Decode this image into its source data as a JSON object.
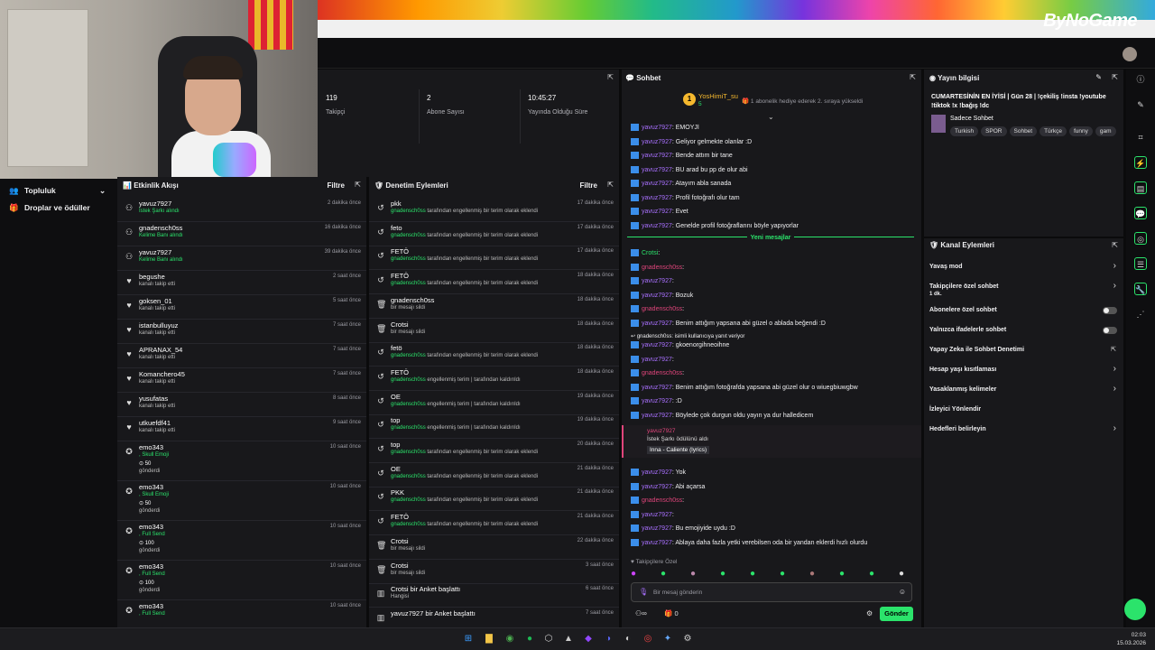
{
  "banner": {
    "logo": "ByNoGame"
  },
  "stats": [
    {
      "value": "119",
      "label": "Takipçi"
    },
    {
      "value": "2",
      "label": "Abone Sayısı"
    },
    {
      "value": "10:45:27",
      "label": "Yayında Olduğu Süre"
    }
  ],
  "side_nav": {
    "items": [
      "Topluluk",
      "Droplar ve ödüller"
    ]
  },
  "activity": {
    "title": "Etkinlik Akışı",
    "filter": "Filtre",
    "items": [
      {
        "name": "yavuz7927",
        "sub": "İstek Şarkı alındı",
        "time": "2 dakika önce",
        "icon": "reward-icon"
      },
      {
        "name": "gnadensch0ss",
        "sub": "Kelime Banı alındı",
        "time": "16 dakika önce",
        "icon": "reward-icon"
      },
      {
        "name": "yavuz7927",
        "sub": "Kelime Banı alındı",
        "time": "39 dakika önce",
        "icon": "reward-icon"
      },
      {
        "name": "begushe",
        "sub": "kanalı takip etti",
        "time": "2 saat önce",
        "icon": "heart-icon"
      },
      {
        "name": "goksen_01",
        "sub": "kanalı takip etti",
        "time": "5 saat önce",
        "icon": "heart-icon"
      },
      {
        "name": "istanbulluyuz",
        "sub": "kanalı takip etti",
        "time": "7 saat önce",
        "icon": "heart-icon"
      },
      {
        "name": "APRANAX_54",
        "sub": "kanalı takip etti",
        "time": "7 saat önce",
        "icon": "heart-icon"
      },
      {
        "name": "Komanchero45",
        "sub": "kanalı takip etti",
        "time": "7 saat önce",
        "icon": "heart-icon"
      },
      {
        "name": "yusufatas",
        "sub": "kanalı takip etti",
        "time": "8 saat önce",
        "icon": "heart-icon"
      },
      {
        "name": "utkuefdf41",
        "sub": "kanalı takip etti",
        "time": "9 saat önce",
        "icon": "heart-icon"
      }
    ],
    "gifts": [
      {
        "name": "emo343",
        "item": ", Skull Emoji",
        "amount": "50",
        "sent": "gönderdi",
        "time": "10 saat önce"
      },
      {
        "name": "emo343",
        "item": ", Skull Emoji",
        "amount": "50",
        "sent": "gönderdi",
        "time": "10 saat önce"
      },
      {
        "name": "emo343",
        "item": ", Full Send",
        "amount": "100",
        "sent": "gönderdi",
        "time": "10 saat önce"
      },
      {
        "name": "emo343",
        "item": ", Full Send",
        "amount": "100",
        "sent": "gönderdi",
        "time": "10 saat önce"
      },
      {
        "name": "emo343",
        "item": ", Full Send",
        "amount": "",
        "sent": "",
        "time": "10 saat önce"
      }
    ]
  },
  "mod": {
    "title": "Denetim Eylemleri",
    "filter": "Filtre",
    "items": [
      {
        "name": "pkk",
        "user": "gnadensch0ss",
        "rest": "tarafından engellenmiş bir terim olarak eklendi",
        "time": "17 dakika önce",
        "icon": "undo-icon"
      },
      {
        "name": "feto",
        "user": "gnadensch0ss",
        "rest": "tarafından engellenmiş bir terim olarak eklendi",
        "time": "17 dakika önce",
        "icon": "undo-icon"
      },
      {
        "name": "FETÖ",
        "user": "gnadensch0ss",
        "rest": "tarafından engellenmiş bir terim olarak eklendi",
        "time": "17 dakika önce",
        "icon": "undo-icon"
      },
      {
        "name": "FETÖ",
        "user": "gnadensch0ss",
        "rest": "tarafından engellenmiş bir terim olarak eklendi",
        "time": "18 dakika önce",
        "icon": "undo-icon"
      },
      {
        "name": "gnadensch0ss",
        "user": "",
        "rest": "bir mesajı sildi",
        "time": "18 dakika önce",
        "icon": "trash-icon"
      },
      {
        "name": "Crotsi",
        "user": "",
        "rest": "bir mesajı sildi",
        "time": "18 dakika önce",
        "icon": "trash-icon"
      },
      {
        "name": "fetö",
        "user": "gnadensch0ss",
        "rest": "tarafından engellenmiş bir terim olarak eklendi",
        "time": "18 dakika önce",
        "icon": "undo-icon"
      },
      {
        "name": "FETÖ",
        "user": "gnadensch0ss",
        "rest": "engellenmiş terim | tarafından kaldırıldı",
        "time": "18 dakika önce",
        "icon": "undo-icon"
      },
      {
        "name": "OE",
        "user": "gnadensch0ss",
        "rest": "engellenmiş terim | tarafından kaldırıldı",
        "time": "19 dakika önce",
        "icon": "undo-icon"
      },
      {
        "name": "top",
        "user": "gnadensch0ss",
        "rest": "engellenmiş terim | tarafından kaldırıldı",
        "time": "19 dakika önce",
        "icon": "undo-icon"
      },
      {
        "name": "top",
        "user": "gnadensch0ss",
        "rest": "tarafından engellenmiş bir terim olarak eklendi",
        "time": "20 dakika önce",
        "icon": "undo-icon"
      },
      {
        "name": "OE",
        "user": "gnadensch0ss",
        "rest": "tarafından engellenmiş bir terim olarak eklendi",
        "time": "21 dakika önce",
        "icon": "undo-icon"
      },
      {
        "name": "PKK",
        "user": "gnadensch0ss",
        "rest": "tarafından engellenmiş bir terim olarak eklendi",
        "time": "21 dakika önce",
        "icon": "undo-icon"
      },
      {
        "name": "FETÖ",
        "user": "gnadensch0ss",
        "rest": "tarafından engellenmiş bir terim olarak eklendi",
        "time": "21 dakika önce",
        "icon": "undo-icon"
      },
      {
        "name": "Crotsi",
        "user": "",
        "rest": "bir mesajı sildi",
        "time": "22 dakika önce",
        "icon": "trash-icon"
      },
      {
        "name": "Crotsi",
        "user": "",
        "rest": "bir mesajı sildi",
        "time": "3 saat önce",
        "icon": "trash-icon"
      },
      {
        "name": "Crotsi bir Anket başlattı",
        "user": "",
        "rest": "Hangisi",
        "time": "6 saat önce",
        "icon": "poll-icon"
      },
      {
        "name": "yavuz7927 bir Anket başlattı",
        "user": "",
        "rest": "",
        "time": "7 saat önce",
        "icon": "poll-icon"
      }
    ]
  },
  "chat": {
    "title": "Sohbet",
    "pinned_user": "YosHimiT_su",
    "pinned_count": "5",
    "pinned_text": "1 abonelik hediye ederek 2. sıraya yükseldi",
    "lines_before": [
      {
        "user": "yavuz7927",
        "text": ": EMOYJİ"
      },
      {
        "user": "yavuz7927",
        "text": ": Geliyor gelmekte olanlar :D"
      },
      {
        "user": "yavuz7927",
        "text": ": Bende attım bir tane"
      },
      {
        "user": "yavuz7927",
        "text": ": BU arad bu pp de olur abi"
      },
      {
        "user": "yavuz7927",
        "text": ": Atayım abla sanada"
      },
      {
        "user": "yavuz7927",
        "text": ": Profil fotoğrafı olur tam"
      },
      {
        "user": "yavuz7927",
        "text": ": Evet"
      },
      {
        "user": "yavuz7927",
        "text": ": Genelde profil fotoğraflarını böyle yapıyorlar"
      }
    ],
    "new_messages": "Yeni mesajlar",
    "lines_after": [
      {
        "user": "Crotsi",
        "text": ":",
        "color": "green"
      },
      {
        "user": "gnadensch0ss",
        "text": ":",
        "color": "pink"
      },
      {
        "user": "yavuz7927",
        "text": ":",
        "color": "purple"
      },
      {
        "user": "yavuz7927",
        "text": ": Bozuk",
        "color": "purple"
      },
      {
        "user": "gnadensch0ss",
        "text": ":",
        "color": "pink"
      },
      {
        "user": "yavuz7927",
        "text": ": Benim attığım yapsana abi güzel o ablada beğendi :D",
        "color": "purple"
      }
    ],
    "reply_note": "gnadensch0ss: isimli kullanıcıya yanıt veriyor",
    "lines_after2": [
      {
        "user": "yavuz7927",
        "text": ": gkoenorgihneoihne",
        "color": "purple"
      },
      {
        "user": "yavuz7927",
        "text": ":",
        "color": "purple"
      },
      {
        "user": "gnadensch0ss",
        "text": ":",
        "color": "pink"
      },
      {
        "user": "yavuz7927",
        "text": ": Benim attığım fotoğrafda yapsana abi güzel olur o wiuegbiuwgbw",
        "color": "purple"
      },
      {
        "user": "yavuz7927",
        "text": ": :D",
        "color": "purple"
      },
      {
        "user": "yavuz7927",
        "text": ": Böylede çok durgun oldu yayın ya dur halledicem",
        "color": "purple"
      }
    ],
    "redeem": {
      "user": "yavuz7927",
      "text": "İstek Şarkı ödülünü aldı",
      "song": "Inna - Caliente (lyrics)"
    },
    "lines_after3": [
      {
        "user": "yavuz7927",
        "text": ": Yok",
        "color": "purple"
      },
      {
        "user": "yavuz7927",
        "text": ": Abi açarsa",
        "color": "purple"
      },
      {
        "user": "gnadensch0ss",
        "text": ":",
        "color": "pink"
      },
      {
        "user": "yavuz7927",
        "text": ":",
        "color": "purple"
      },
      {
        "user": "yavuz7927",
        "text": ": Bu emojiyide uydu :D",
        "color": "purple"
      },
      {
        "user": "yavuz7927",
        "text": ": Ablaya daha fazla yetki verebilsen oda bir yandan eklerdi hızlı olurdu",
        "color": "purple"
      }
    ],
    "followers_only": "Takipçilere Özel",
    "input_placeholder": "Bir mesaj gönderin",
    "points": "0",
    "send": "Gönder"
  },
  "info": {
    "title": "Yayın bilgisi",
    "stream_title": "CUMARTESİNİN EN İYİSİ | Gün 28 | !çekiliş !insta !youtube !tiktok !x !bağış !dc",
    "category": "Sadece Sohbet",
    "tags": [
      "Turkish",
      "SPOR",
      "Sohbet",
      "Türkçe",
      "funny",
      "gam"
    ]
  },
  "actions": {
    "title": "Kanal Eylemleri",
    "items": [
      {
        "label": "Yavaş mod",
        "kind": "chevron"
      },
      {
        "label": "Takipçilere özel sohbet",
        "sub": "1 dk.",
        "kind": "chevron"
      },
      {
        "label": "Abonelere özel sohbet",
        "kind": "toggle"
      },
      {
        "label": "Yalnızca ifadelerle sohbet",
        "kind": "toggle"
      },
      {
        "label": "Yapay Zeka ile Sohbet Denetimi",
        "kind": "external"
      },
      {
        "label": "Hesap yaşı kısıtlaması",
        "kind": "chevron"
      },
      {
        "label": "Yasaklanmış kelimeler",
        "kind": "chevron"
      },
      {
        "label": "İzleyici Yönlendir",
        "kind": "none"
      },
      {
        "label": "Hedefleri belirleyin",
        "kind": "chevron"
      }
    ]
  },
  "taskbar": {
    "time": "02:03",
    "date": "15.03.2026"
  }
}
